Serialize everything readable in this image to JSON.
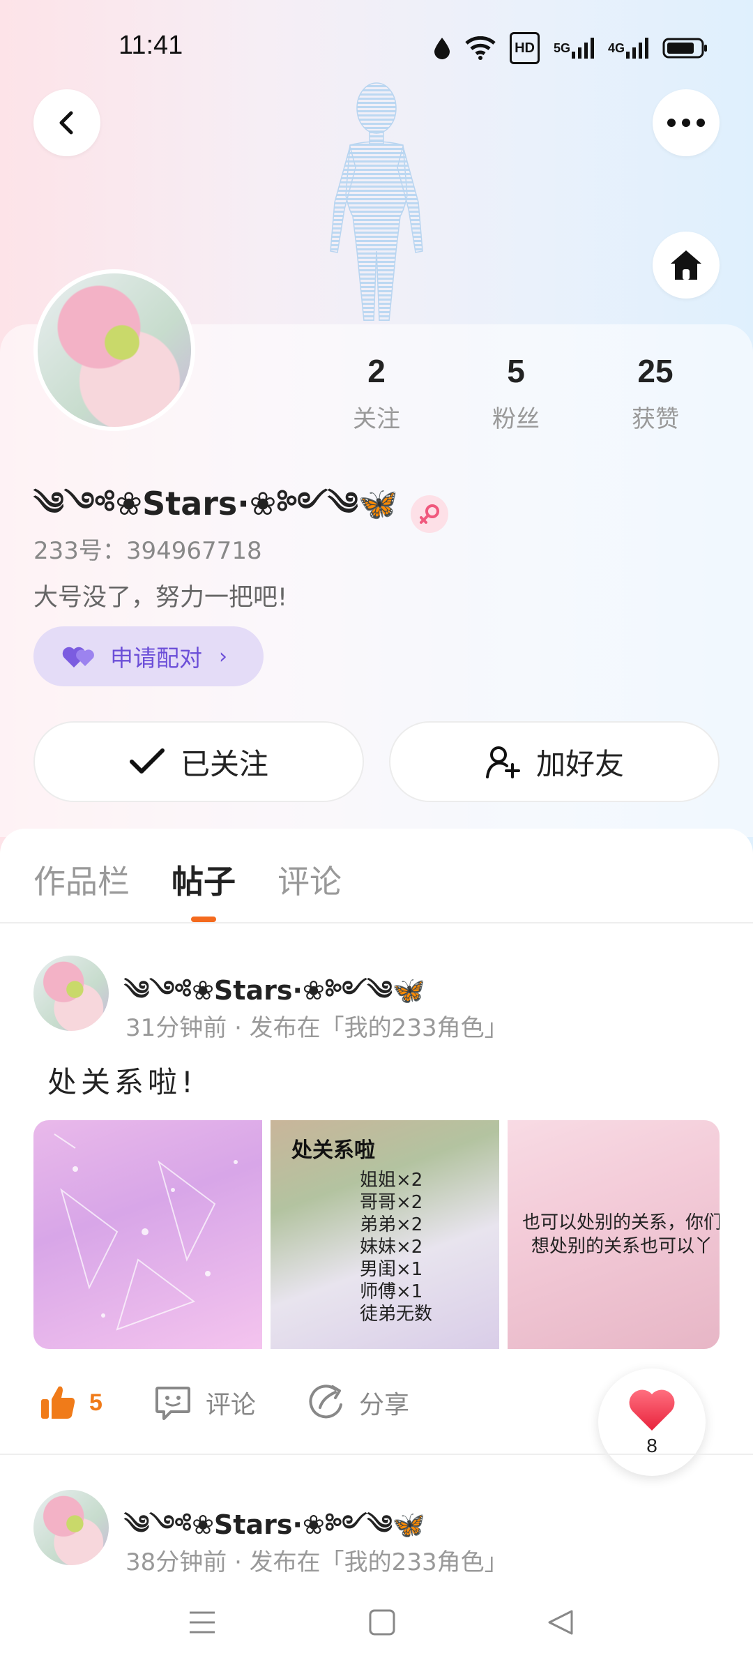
{
  "status_bar": {
    "time": "11:41",
    "hd": "HD",
    "net1": "5G",
    "net2": "4G"
  },
  "profile": {
    "username": "༄༺❀Stars·❀༻༄🦋",
    "uid_label": "233号：394967718",
    "bio": "大号没了，努力一把吧!",
    "pair_label": "申请配对",
    "stats": [
      {
        "num": "2",
        "label": "关注"
      },
      {
        "num": "5",
        "label": "粉丝"
      },
      {
        "num": "25",
        "label": "获赞"
      }
    ],
    "follow_label": "已关注",
    "add_friend_label": "加好友"
  },
  "tabs": [
    {
      "label": "作品栏"
    },
    {
      "label": "帖子"
    },
    {
      "label": "评论"
    }
  ],
  "posts": [
    {
      "author": "༄༺❀Stars·❀༻༄🦋",
      "meta": "31分钟前 · 发布在「我的233角色」",
      "text": "处关系啦!",
      "image2_title": "处关系啦",
      "image2_lines": [
        "姐姐×2",
        "哥哥×2",
        "弟弟×2",
        "妹妹×2",
        "男闺×1",
        "师傅×1",
        "徒弟无数"
      ],
      "image3_caption": "也可以处别的关系，你们想处别的关系也可以丫",
      "likes": "5",
      "comment_label": "评论",
      "share_label": "分享"
    },
    {
      "author": "༄༺❀Stars·❀༻༄🦋",
      "meta": "38分钟前 · 发布在「我的233角色」"
    }
  ],
  "float_like_count": "8",
  "colors": {
    "accent": "#f46a1e",
    "pair": "#6c4fd8",
    "like": "#f07b19",
    "heart": "#f0465a"
  }
}
